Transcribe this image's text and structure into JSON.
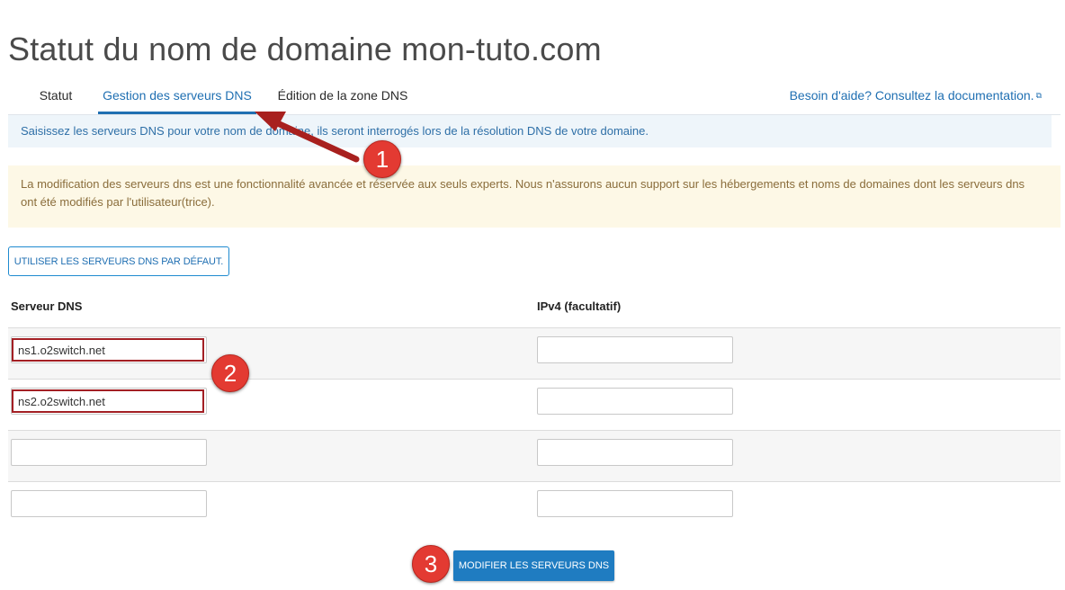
{
  "page": {
    "title": "Statut du nom de domaine mon-tuto.com"
  },
  "tabs": [
    {
      "label": "Statut"
    },
    {
      "label": "Gestion des serveurs DNS"
    },
    {
      "label": "Édition de la zone DNS"
    }
  ],
  "help_link": {
    "label": "Besoin d'aide? Consultez la documentation.",
    "icon": "external-link-icon"
  },
  "info_text": "Saisissez les serveurs DNS pour votre nom de domaine, ils seront interrogés lors de la résolution DNS de votre domaine.",
  "warning_text": "La modification des serveurs dns est une fonctionnalité avancée et réservée aux seuls experts. Nous n'assurons aucun support sur les hébergements et noms de domaines dont les serveurs dns ont été modifiés par l'utilisateur(trice).",
  "default_button": {
    "label": "UTILISER LES SERVEURS DNS PAR DÉFAUT."
  },
  "table": {
    "headers": [
      "Serveur DNS",
      "IPv4 (facultatif)"
    ],
    "rows": [
      {
        "dns": "ns1.o2switch.net",
        "ipv4": ""
      },
      {
        "dns": "ns2.o2switch.net",
        "ipv4": ""
      },
      {
        "dns": "",
        "ipv4": ""
      },
      {
        "dns": "",
        "ipv4": ""
      }
    ]
  },
  "submit_button": {
    "label": "MODIFIER LES SERVEURS DNS"
  },
  "annotations": {
    "badges": [
      "1",
      "2",
      "3"
    ]
  },
  "colors": {
    "accent": "#1f7cc1",
    "link": "#1f6fb2",
    "info_bg": "#eef5fa",
    "warning_bg": "#fdf8e6",
    "annotation_red": "#e33a32",
    "highlight_border": "#a31f24"
  }
}
